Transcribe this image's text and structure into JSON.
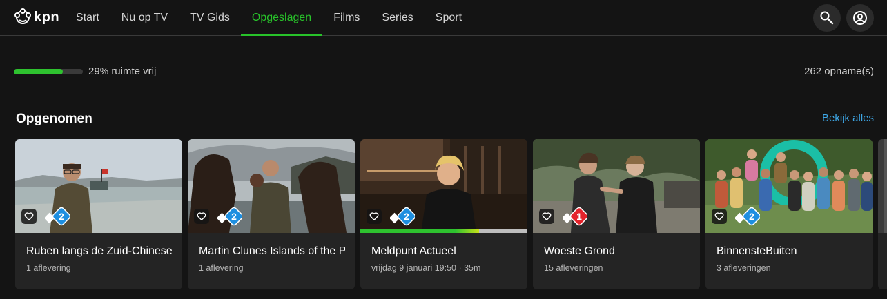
{
  "header": {
    "logo_text": "kpn",
    "nav": [
      {
        "label": "Start",
        "active": false
      },
      {
        "label": "Nu op TV",
        "active": false
      },
      {
        "label": "TV Gids",
        "active": false
      },
      {
        "label": "Opgeslagen",
        "active": true
      },
      {
        "label": "Films",
        "active": false
      },
      {
        "label": "Series",
        "active": false
      },
      {
        "label": "Sport",
        "active": false
      }
    ],
    "search_icon": "search-icon",
    "profile_icon": "user-icon"
  },
  "storage": {
    "free_fraction": 0.71,
    "pct": "29",
    "pct_sign": "%",
    "label": "ruimte vrij",
    "recordings_count": "262 opname(s)"
  },
  "section": {
    "title": "Opgenomen",
    "see_all": "Bekijk alles"
  },
  "cards": [
    {
      "title": "Ruben langs de Zuid-Chinese",
      "meta": "1 aflevering",
      "channel": "NPO 2",
      "progress": null
    },
    {
      "title": "Martin Clunes Islands of the Pacific",
      "meta": "1 aflevering",
      "channel": "NPO 2",
      "progress": null
    },
    {
      "title": "Meldpunt Actueel",
      "meta": "vrijdag 9 januari 19:50 · 35m",
      "channel": "NPO 2",
      "progress": 0.71
    },
    {
      "title": "Woeste Grond",
      "meta": "15 afleveringen",
      "channel": "NPO 1",
      "progress": null
    },
    {
      "title": "BinnensteBuiten",
      "meta": "3 afleveringen",
      "channel": "NPO 2",
      "progress": null
    }
  ],
  "colors": {
    "accent": "#28c32a",
    "link": "#3ea7e6",
    "background": "#141414",
    "card": "#242424"
  }
}
